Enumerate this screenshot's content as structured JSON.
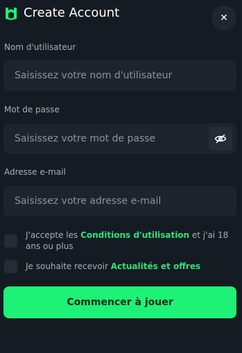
{
  "header": {
    "title": "Create Account",
    "close_icon_char": "✕"
  },
  "form": {
    "username": {
      "label": "Nom d'utilisateur",
      "placeholder": "Saisissez votre nom d'utilisateur"
    },
    "password": {
      "label": "Mot de passe",
      "placeholder": "Saisissez votre mot de passe"
    },
    "email": {
      "label": "Adresse e-mail",
      "placeholder": "Saisissez votre adresse e-mail"
    }
  },
  "consents": {
    "terms": {
      "prefix": "J'accepte les ",
      "link": "Conditions d'utilisation",
      "suffix": " et j'ai 18 ans ou plus"
    },
    "news": {
      "prefix": "Je souhaite recevoir ",
      "link": "Actualités et offres"
    }
  },
  "cta": {
    "label": "Commencer à jouer"
  },
  "colors": {
    "background": "#151b22",
    "field": "#1d242c",
    "accent": "#1df277",
    "link": "#2ee07d"
  },
  "icons": {
    "logo": "brand-logo-icon",
    "close": "close-icon",
    "eye": "eye-off-icon"
  }
}
